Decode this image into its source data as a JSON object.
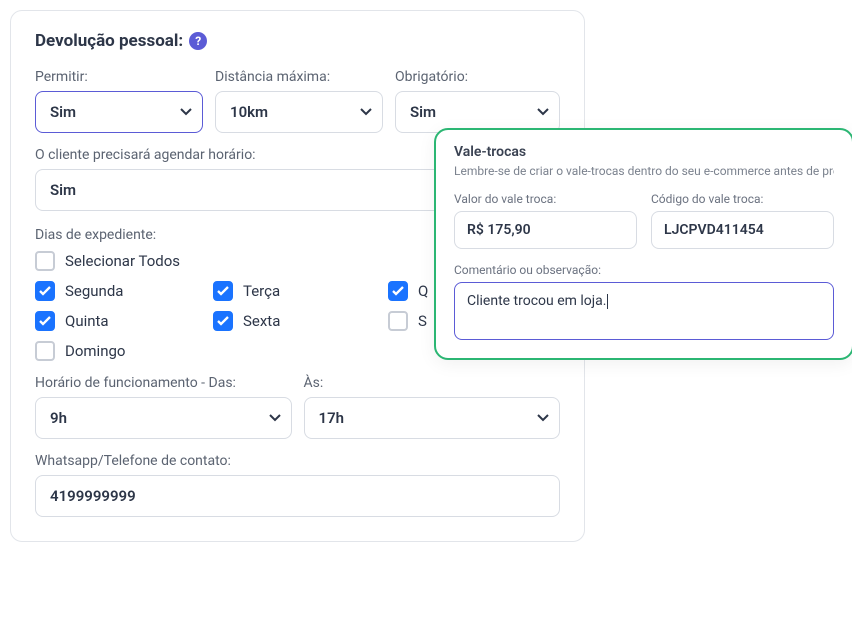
{
  "panel": {
    "title": "Devolução pessoal:",
    "permit": {
      "label": "Permitir:",
      "value": "Sim"
    },
    "distance": {
      "label": "Distância máxima:",
      "value": "10km"
    },
    "required": {
      "label": "Obrigatório:",
      "value": "Sim"
    },
    "schedule": {
      "label": "O cliente precisará agendar horário:",
      "value": "Sim"
    },
    "days_label": "Dias de expediente:",
    "days": {
      "select_all": {
        "label": "Selecionar Todos",
        "checked": false
      },
      "mon": {
        "label": "Segunda",
        "checked": true
      },
      "tue": {
        "label": "Terça",
        "checked": true
      },
      "wed": {
        "label": "Q",
        "checked": true
      },
      "thu": {
        "label": "Quinta",
        "checked": true
      },
      "fri": {
        "label": "Sexta",
        "checked": true
      },
      "sat": {
        "label": "S",
        "checked": false
      },
      "sun": {
        "label": "Domingo",
        "checked": false
      }
    },
    "hours_from_label": "Horário de funcionamento - Das:",
    "hours_to_label": "Às:",
    "hours_from": "9h",
    "hours_to": "17h",
    "phone_label": "Whatsapp/Telefone de contato:",
    "phone": "4199999999"
  },
  "voucher": {
    "title": "Vale-trocas",
    "subtitle": "Lembre-se de criar o vale-trocas dentro do seu e-commerce antes de pree",
    "value_label": "Valor do vale troca:",
    "value": "R$ 175,90",
    "code_label": "Código do vale troca:",
    "code": "LJCPVD411454",
    "comment_label": "Comentário ou observação:",
    "comment": "Cliente trocou em loja."
  }
}
